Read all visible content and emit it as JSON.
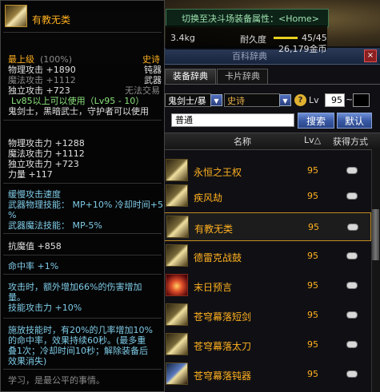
{
  "tooltip": {
    "item_name": "有教无类",
    "grade_label": "最上级",
    "grade_pct": "(100%)",
    "rarity": "史诗",
    "type_lines": [
      {
        "label": "物理攻击 +1890",
        "right": "钝器"
      },
      {
        "label": "魔法攻击 +1112",
        "right": "武器"
      },
      {
        "label": "独立攻击 +723",
        "right": "无法交易"
      }
    ],
    "level_req": "Lv85以上可以使用（Lv95 - 10）",
    "classes": "鬼剑士，黑暗武士，守护者可以使用",
    "stats": [
      "物理攻击力 +1288",
      "魔法攻击力 +1112",
      "独立攻击力 +723",
      "力量 +117"
    ],
    "effects": [
      "缓慢攻击速度",
      "武器物理技能： MP+10% 冷却时间+5",
      "%",
      "武器魔法技能： MP-5%"
    ],
    "anti_demon": "抗魔值 +858",
    "hit": "命中率 +1%",
    "extra": [
      "攻击时，额外增加66%的伤害增加",
      "量。",
      "技能攻击力 +10%"
    ],
    "proc": [
      "施放技能时，有20%的几率增加10%",
      "的命中率，效果持续60秒。(最多重",
      "叠1次；冷却时间10秒；解除装备后",
      "效果消失)"
    ],
    "flavor": "学习，是最公平的事情。"
  },
  "pvp_tip": {
    "text": "切换至决斗场装备属性：<Home>",
    "weight": "3.4kg",
    "durability_label": "耐久度",
    "durability": "45/45",
    "durability_fraction": 1.0,
    "gold": "26,179金币"
  },
  "dictionary": {
    "title": "百科辞典",
    "close": "×",
    "tabs": [
      "装备辞典",
      "卡片辞典"
    ],
    "class_filter": "鬼剑士/暴",
    "rarity_filter": "史诗",
    "lv_label": "Lv",
    "lv_min": "95",
    "lv_tilde": "~",
    "search_value": "普通",
    "search_button": "搜索",
    "default_button": "默认",
    "headers": {
      "name": "名称",
      "lv": "Lv△",
      "get": "获得方式"
    },
    "items": [
      {
        "name": "永恒之王权",
        "lv": "95"
      },
      {
        "name": "疾风劫",
        "lv": "95"
      },
      {
        "name": "有教无类",
        "lv": "95"
      },
      {
        "name": "德雷克战鼓",
        "lv": "95"
      },
      {
        "name": "末日预言",
        "lv": "95"
      },
      {
        "name": "苍穹幕落短剑",
        "lv": "95"
      },
      {
        "name": "苍穹幕落太刀",
        "lv": "95"
      },
      {
        "name": "苍穹幕落钝器",
        "lv": "95"
      }
    ]
  }
}
